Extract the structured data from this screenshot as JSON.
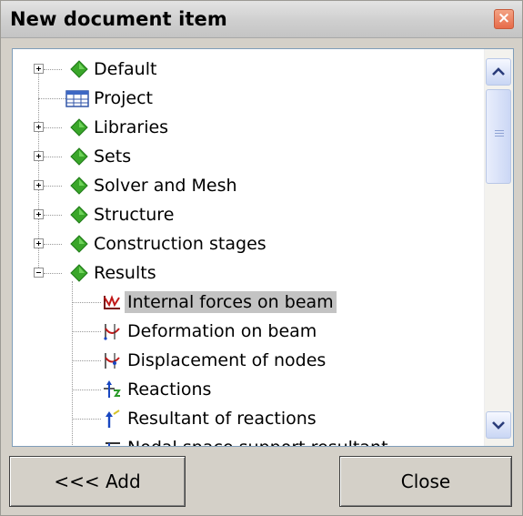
{
  "window": {
    "title": "New document item",
    "close_label": "×"
  },
  "tree": {
    "items": [
      {
        "label": "Default",
        "icon": "diamond-icon",
        "expander": "plus",
        "level": 0
      },
      {
        "label": "Project",
        "icon": "table-icon",
        "expander": "none",
        "level": 0
      },
      {
        "label": "Libraries",
        "icon": "diamond-icon",
        "expander": "plus",
        "level": 0
      },
      {
        "label": "Sets",
        "icon": "diamond-icon",
        "expander": "plus",
        "level": 0
      },
      {
        "label": "Solver and Mesh",
        "icon": "diamond-icon",
        "expander": "plus",
        "level": 0
      },
      {
        "label": "Structure",
        "icon": "diamond-icon",
        "expander": "plus",
        "level": 0
      },
      {
        "label": "Construction stages",
        "icon": "diamond-icon",
        "expander": "plus",
        "level": 0
      },
      {
        "label": "Results",
        "icon": "diamond-icon",
        "expander": "minus",
        "level": 0
      },
      {
        "label": "Internal forces on beam",
        "icon": "internal-forces-icon",
        "expander": "none",
        "level": 1,
        "selected": true
      },
      {
        "label": "Deformation on beam",
        "icon": "deformation-icon",
        "expander": "none",
        "level": 1
      },
      {
        "label": "Displacement of nodes",
        "icon": "displacement-icon",
        "expander": "none",
        "level": 1
      },
      {
        "label": "Reactions",
        "icon": "reactions-icon",
        "expander": "none",
        "level": 1
      },
      {
        "label": "Resultant of reactions",
        "icon": "resultant-icon",
        "expander": "none",
        "level": 1
      },
      {
        "label": "Nodal space support resultant",
        "icon": "support-icon",
        "expander": "none",
        "level": 1
      }
    ]
  },
  "buttons": {
    "add_label": "<<< Add",
    "close_label": "Close"
  },
  "colors": {
    "diamond": "#3aa62a",
    "selection": "#c3c3c3"
  }
}
